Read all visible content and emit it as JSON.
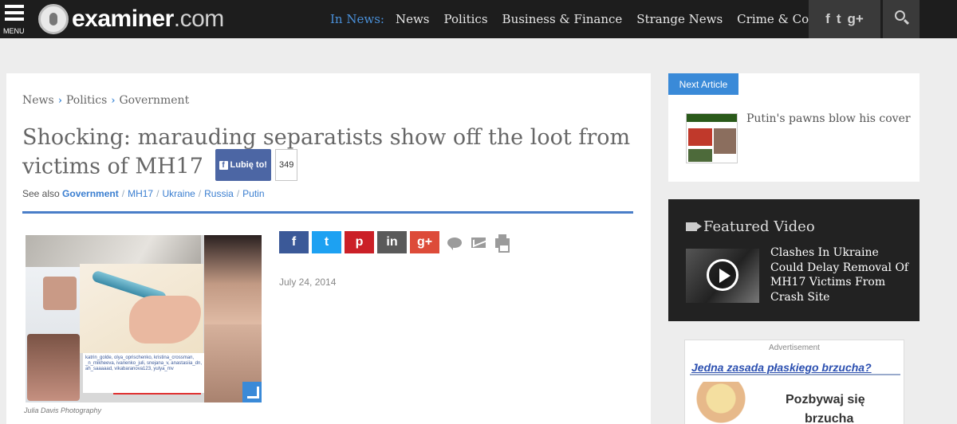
{
  "topbar": {
    "menu_label": "MENU",
    "logo_bold": "examiner",
    "logo_light": ".com",
    "in_news": "In News:",
    "nav": [
      "News",
      "Politics",
      "Business & Finance",
      "Strange News",
      "Crime & Courts"
    ],
    "social": {
      "facebook": "f",
      "twitter": "t",
      "googleplus": "g+"
    }
  },
  "article": {
    "breadcrumb": [
      "News",
      "Politics",
      "Government"
    ],
    "headline": "Shocking: marauding separatists show off the loot from victims of MH17",
    "like_label": "Lubię to!",
    "like_count": "349",
    "see_also_label": "See also",
    "tags": [
      "Government",
      "MH17",
      "Ukraine",
      "Russia",
      "Putin"
    ],
    "photo_comments": "katrin_golde, olya_oprischenko, kristina_crossman, _n_mikheeva, ivanenko_juli, snejana_v, anastasiia_dn, ah_saaaaad, vikabaranova123, yulya_mv",
    "photo_credit": "Julia Davis Photography",
    "date": "July 24, 2014",
    "share": [
      {
        "label": "f",
        "color": "#3b5998"
      },
      {
        "label": "t",
        "color": "#1da1f2"
      },
      {
        "label": "p",
        "color": "#cb2027"
      },
      {
        "label": "in",
        "color": "#5a5a5a"
      },
      {
        "label": "g+",
        "color": "#dd4b39"
      }
    ]
  },
  "sidebar": {
    "next_label": "Next Article",
    "next_title": "Putin's pawns blow his cover",
    "featured_heading": "Featured Video",
    "video_title": "Clashes In Ukraine Could Delay Removal Of MH17 Victims From Crash Site",
    "ad_label": "Advertisement",
    "ad_headline": "Jedna zasada płaskiego brzucha?",
    "ad_copy": "Pozbywaj się",
    "ad_copy2": "brzucha"
  }
}
